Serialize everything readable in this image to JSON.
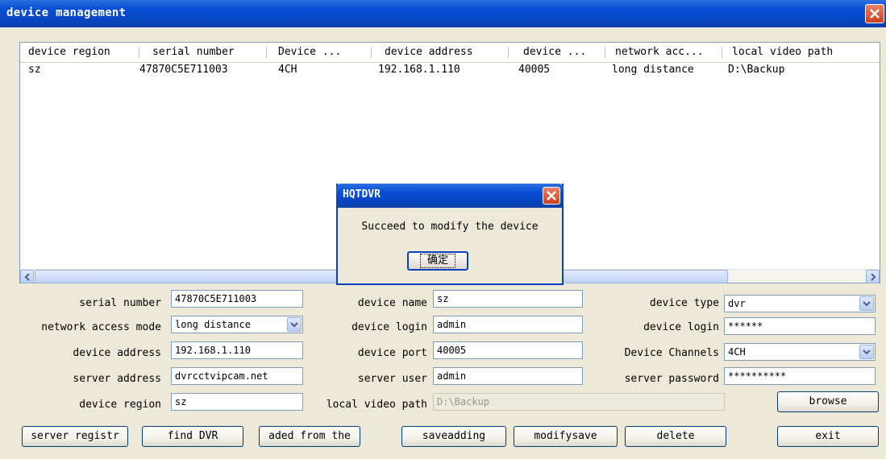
{
  "window": {
    "title": "device management"
  },
  "list": {
    "columns": [
      "device region",
      "serial number",
      "Device ...",
      "device address",
      "device ...",
      "network acc...",
      "local video path"
    ],
    "rows": [
      [
        "sz",
        "47870C5E711003",
        "4CH",
        "192.168.1.110",
        "40005",
        "long distance",
        "D:\\Backup"
      ]
    ]
  },
  "form": {
    "serial_number": {
      "label": "serial number",
      "value": "47870C5E711003"
    },
    "device_name": {
      "label": "device name",
      "value": "sz"
    },
    "device_type": {
      "label": "device type",
      "value": "dvr"
    },
    "network_access_mode": {
      "label": "network access mode",
      "value": "long distance"
    },
    "device_login_user": {
      "label": "device login",
      "value": "admin"
    },
    "device_login_password": {
      "label": "device login",
      "value": "******"
    },
    "device_address": {
      "label": "device address",
      "value": "192.168.1.110"
    },
    "device_port": {
      "label": "device port",
      "value": "40005"
    },
    "device_channels": {
      "label": "Device Channels",
      "value": "4CH"
    },
    "server_address": {
      "label": "server address",
      "value": "dvrcctvipcam.net"
    },
    "server_user": {
      "label": "server user",
      "value": "admin"
    },
    "server_password": {
      "label": "server password",
      "value": "**********"
    },
    "device_region": {
      "label": "device region",
      "value": "sz"
    },
    "local_video_path": {
      "label": "local video path",
      "value": "D:\\Backup"
    },
    "browse": "browse"
  },
  "buttons": {
    "server_registr": "server registr",
    "find_dvr": "find DVR",
    "aded_from": "aded from the",
    "saveadding": "saveadding",
    "modifysave": "modifysave",
    "delete": "delete",
    "exit": "exit"
  },
  "dialog": {
    "title": "HQTDVR",
    "message": "Succeed to modify the device",
    "ok": "确定"
  },
  "colors": {
    "titlebar": "#0a4fd6",
    "close": "#c9411d",
    "face": "#ece9d8"
  }
}
